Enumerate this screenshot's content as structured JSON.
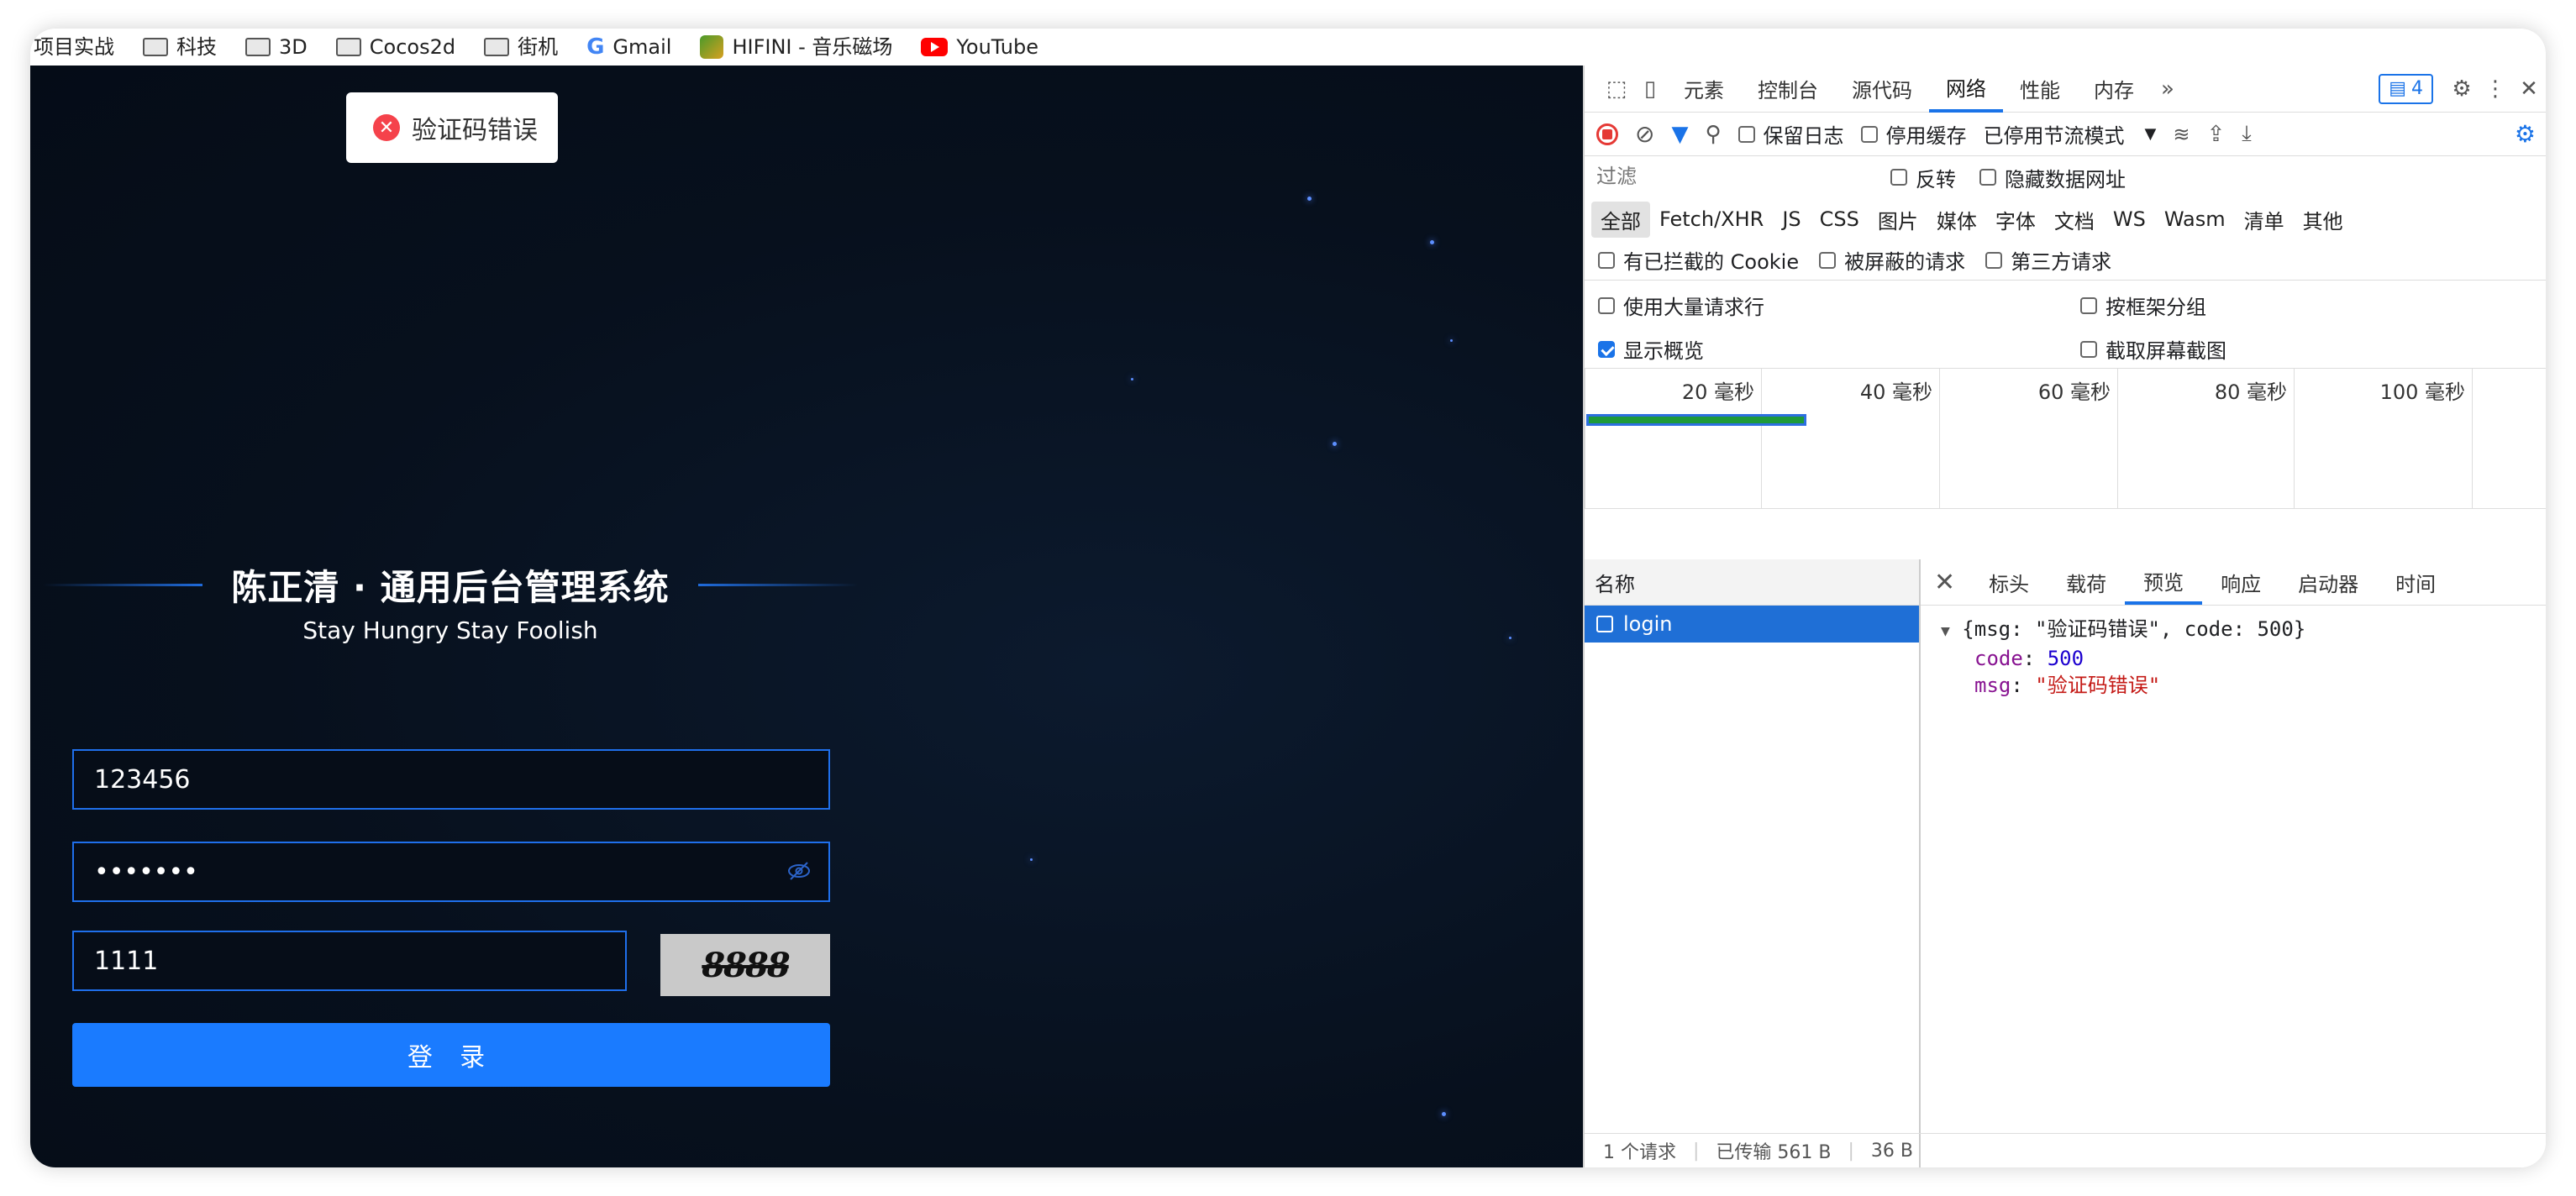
{
  "bookmarks": [
    {
      "label": "项目实战",
      "icon": "folder-icon"
    },
    {
      "label": "科技",
      "icon": "folder-icon"
    },
    {
      "label": "3D",
      "icon": "folder-icon"
    },
    {
      "label": "Cocos2d",
      "icon": "folder-icon"
    },
    {
      "label": "街机",
      "icon": "folder-icon"
    },
    {
      "label": "Gmail",
      "icon": "google-icon"
    },
    {
      "label": "HIFINI - 音乐磁场",
      "icon": "hifini-icon"
    },
    {
      "label": "YouTube",
      "icon": "youtube-icon"
    }
  ],
  "toast": {
    "message": "验证码错误",
    "icon": "error-icon",
    "color": "#f5424b"
  },
  "login": {
    "title": "陈正清 · 通用后台管理系统",
    "subtitle": "Stay Hungry Stay Foolish",
    "username": "123456",
    "password": "•••••••",
    "captcha_input": "1111",
    "captcha_image_text": "8888",
    "submit_label": "登 录",
    "accent": "#1a7bff"
  },
  "devtools": {
    "tabs": [
      "元素",
      "控制台",
      "源代码",
      "网络",
      "性能",
      "内存"
    ],
    "active_tab": "网络",
    "message_count": "4",
    "toolbar": {
      "preserve_log": "保留日志",
      "disable_cache": "停用缓存",
      "throttling": "已停用节流模式"
    },
    "filter": {
      "placeholder": "过滤",
      "invert": "反转",
      "hide_data_urls": "隐藏数据网址"
    },
    "types": [
      "全部",
      "Fetch/XHR",
      "JS",
      "CSS",
      "图片",
      "媒体",
      "字体",
      "文档",
      "WS",
      "Wasm",
      "清单",
      "其他"
    ],
    "extra_filters": [
      "有已拦截的 Cookie",
      "被屏蔽的请求",
      "第三方请求"
    ],
    "options": {
      "large_rows": "使用大量请求行",
      "group_by_frame": "按框架分组",
      "show_overview": "显示概览",
      "capture_screenshots": "截取屏幕截图"
    },
    "timeline_labels": [
      "20 毫秒",
      "40 毫秒",
      "60 毫秒",
      "80 毫秒",
      "100 毫秒"
    ],
    "names_header": "名称",
    "request_name": "login",
    "detail_tabs": [
      "标头",
      "载荷",
      "预览",
      "响应",
      "启动器",
      "时间"
    ],
    "active_detail_tab": "预览",
    "preview": {
      "summary": "{msg: \"验证码错误\", code: 500}",
      "code_key": "code",
      "code_value": "500",
      "msg_key": "msg",
      "msg_value": "\"验证码错误\""
    },
    "status": {
      "requests": "1 个请求",
      "transferred": "已传输 561 B",
      "resources": "36 B"
    }
  }
}
